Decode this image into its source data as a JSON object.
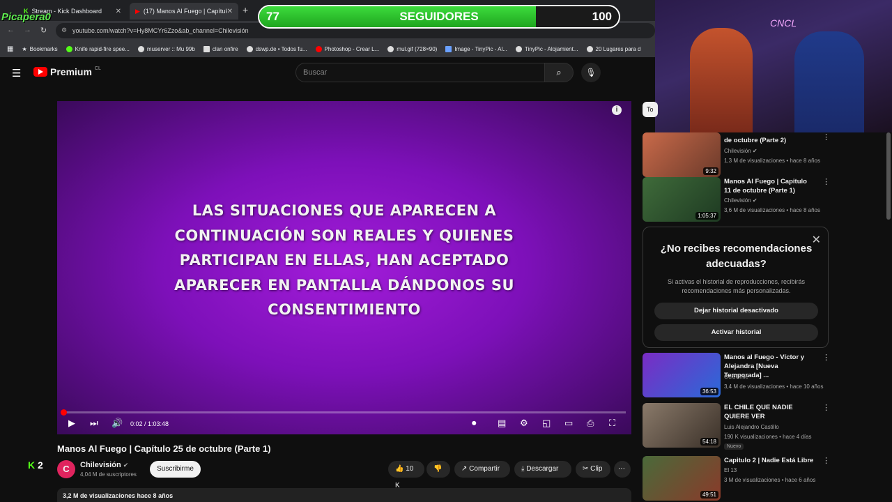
{
  "browser": {
    "tabs": [
      {
        "label": "Stream - Kick Dashboard",
        "icon": "kick-icon"
      },
      {
        "label": "(17) Manos Al Fuego | Capítulo",
        "icon": "youtube-icon"
      }
    ],
    "url": "youtube.com/watch?v=Hy8MCYr6Zzo&ab_channel=Chilevisión",
    "bookmarks": [
      "Bookmarks",
      "Knife rapid-fire spee...",
      "muserver :: Mu 99b",
      "clan onfire",
      "dswp.de • Todos fu...",
      "Photoshop - Crear L...",
      "mul.gif (728×90)",
      "Image - TinyPic - Al...",
      "TinyPic - Alojamient...",
      "20 Lugares para d"
    ]
  },
  "overlay": {
    "logo": "Picapera0",
    "followers_current": "77",
    "followers_label": "SEGUIDORES",
    "followers_goal": "100",
    "followers_progress": 0.77,
    "cam_sign": "CNCL"
  },
  "youtube": {
    "brand": "Premium",
    "region": "CL",
    "search_placeholder": "Buscar",
    "disclaimer": "LAS SITUACIONES QUE APARECEN A CONTINUACIÓN SON REALES Y QUIENES PARTICIPAN EN ELLAS, HAN ACEPTADO APARECER EN PANTALLA DÁNDONOS SU CONSENTIMIENTO",
    "time": "0:02 / 1:03:48",
    "video_title": "Manos Al Fuego | Capítulo 25 de octubre (Parte 1)",
    "channel": "Chilevisión",
    "subscribers": "4,04 M de suscriptores",
    "subscribe_label": "Suscribirme",
    "likes": "10 K",
    "share_label": "Compartir",
    "download_label": "Descargar",
    "clip_label": "Clip",
    "views_line": "3,2 M de visualizaciones  hace 8 años",
    "kick_viewers": "2",
    "chip_label": "To"
  },
  "recommendations": [
    {
      "title": "de octubre (Parte 2)",
      "channel": "Chilevisión",
      "meta": "1,3 M de visualizaciones • hace 8 años",
      "duration": "9:32"
    },
    {
      "title": "Manos Al Fuego | Capitulo 11 de octubre (Parte 1)",
      "channel": "Chilevisión",
      "meta": "3,6 M de visualizaciones • hace 8 años",
      "duration": "1:05:37"
    },
    {
      "title": "Manos al Fuego - Víctor y Alejandra [Nueva Temporada] ...",
      "channel": "OcioChile",
      "meta": "3,4 M de visualizaciones • hace 10 años",
      "duration": "36:53"
    },
    {
      "title": "EL CHILE QUE NADIE QUIERE VER",
      "channel": "Luis Alejandro Castillo",
      "meta": "190 K visualizaciones • hace 4 días",
      "duration": "54:18",
      "badge": "Nuevo"
    },
    {
      "title": "Capitulo 2 | Nadie Está Libre",
      "channel": "El 13",
      "meta": "3 M de visualizaciones • hace 6 años",
      "duration": "49:51"
    }
  ],
  "history_prompt": {
    "title": "¿No recibes recomendaciones adecuadas?",
    "body": "Si activas el historial de reproducciones, recibirás recomendaciones más personalizadas.",
    "keep_off": "Dejar historial desactivado",
    "enable": "Activar historial"
  }
}
